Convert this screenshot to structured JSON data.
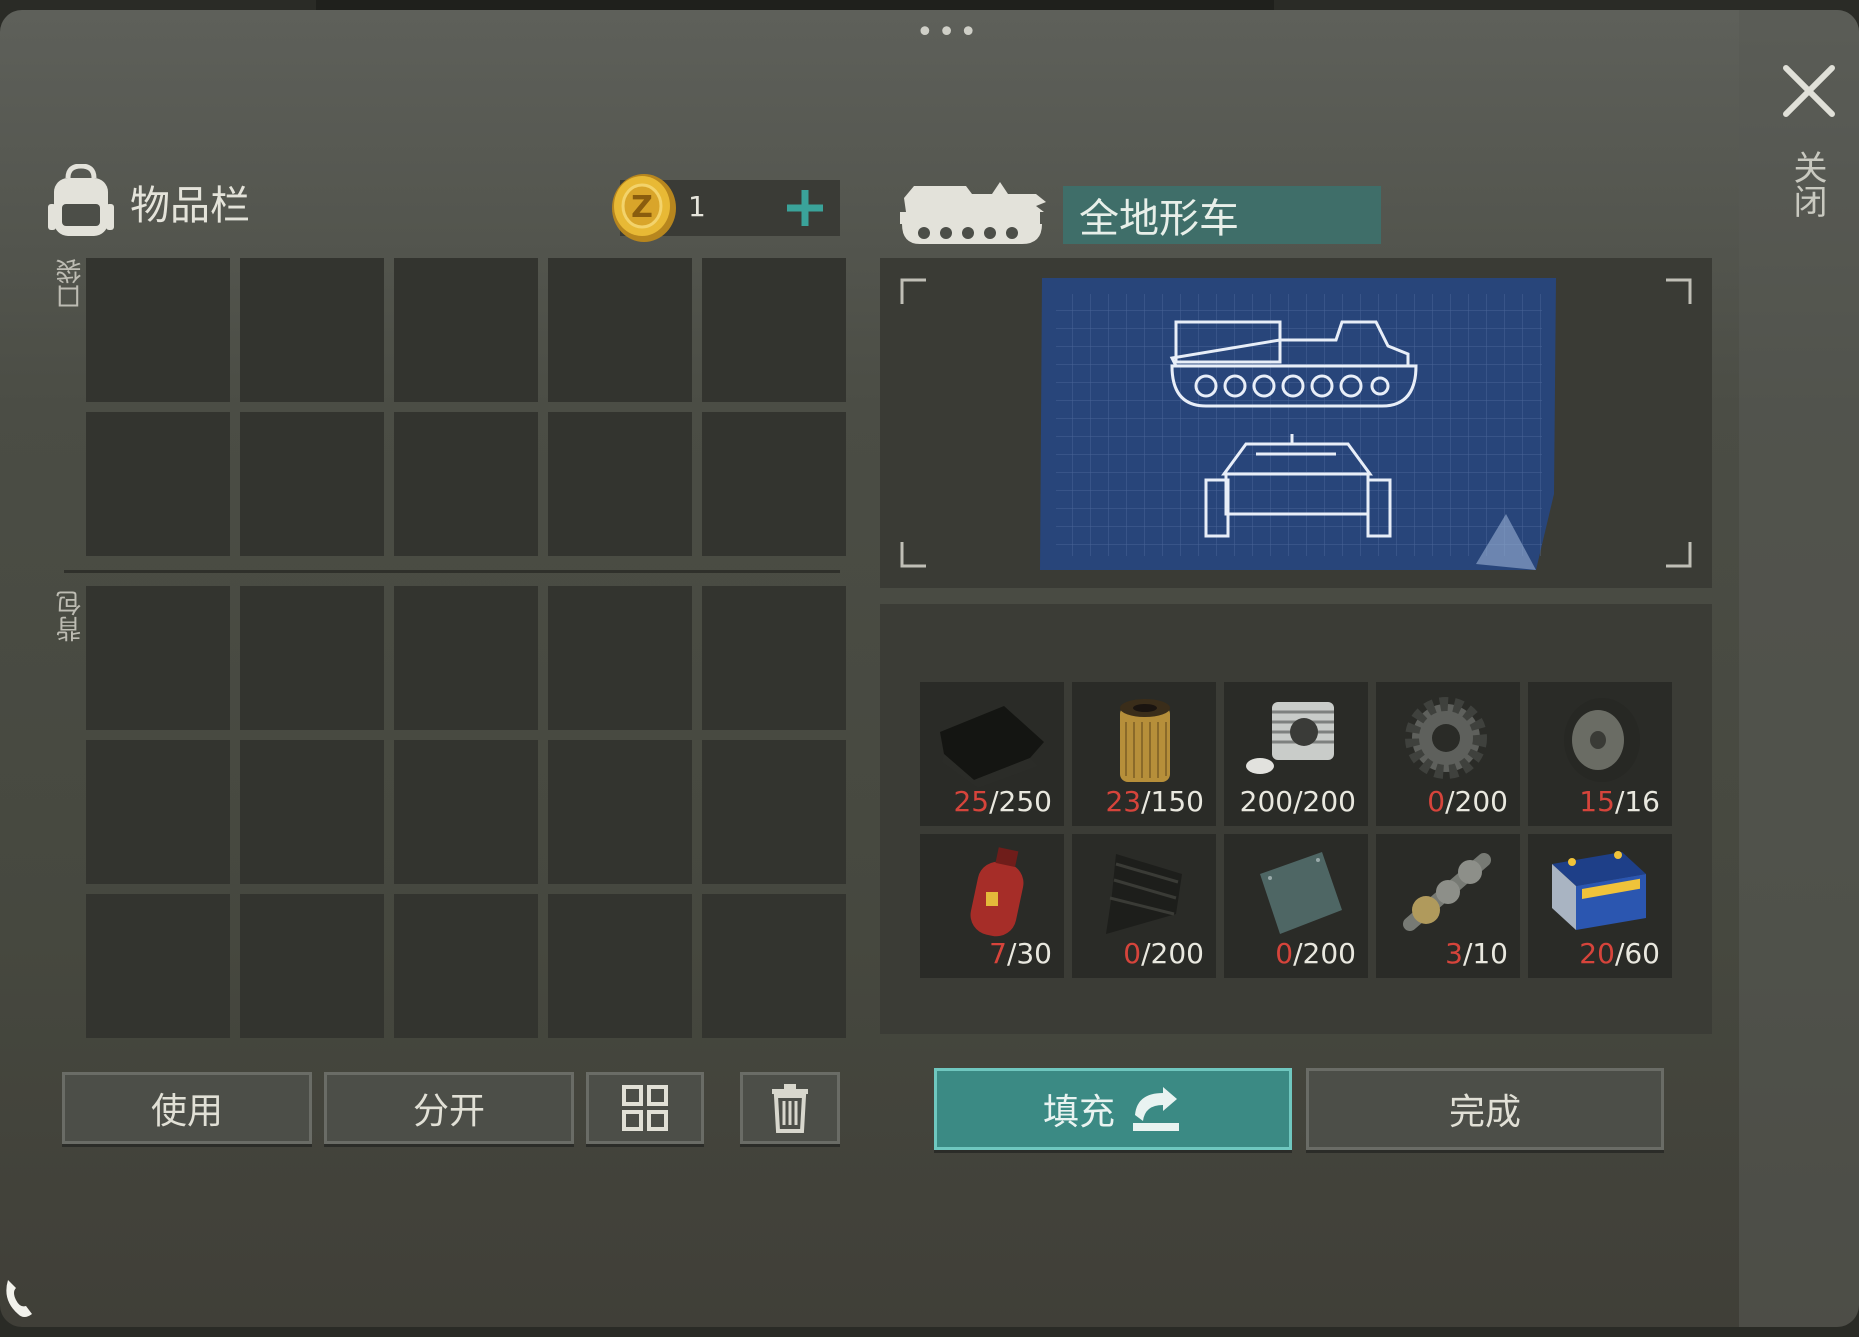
{
  "window": {
    "close_label": "关闭"
  },
  "inventory": {
    "title": "物品栏",
    "coins": "1",
    "pocket_label": "口袋",
    "backpack_label": "背包"
  },
  "buttons": {
    "use": "使用",
    "split": "分开",
    "fill": "填充",
    "done": "完成"
  },
  "vehicle": {
    "name": "全地形车"
  },
  "materials": [
    {
      "name": "rubber-sheet",
      "have": "25",
      "need": "/250"
    },
    {
      "name": "oil-filter",
      "have": "23",
      "need": "/150"
    },
    {
      "name": "engine-cylinder",
      "have": "",
      "need": "200/200"
    },
    {
      "name": "gear",
      "have": "0",
      "need": "/200"
    },
    {
      "name": "wheel",
      "have": "15",
      "need": "/16"
    },
    {
      "name": "gas-cylinder",
      "have": "7",
      "need": "/30"
    },
    {
      "name": "carbon-fabric",
      "have": "0",
      "need": "/200"
    },
    {
      "name": "metal-plate",
      "have": "0",
      "need": "/200"
    },
    {
      "name": "camshaft",
      "have": "3",
      "need": "/10"
    },
    {
      "name": "battery",
      "have": "20",
      "need": "/60"
    }
  ],
  "colors": {
    "accent": "#3b8a84",
    "counter_red": "#d6443b",
    "coin_plus": "#3aa39a"
  }
}
